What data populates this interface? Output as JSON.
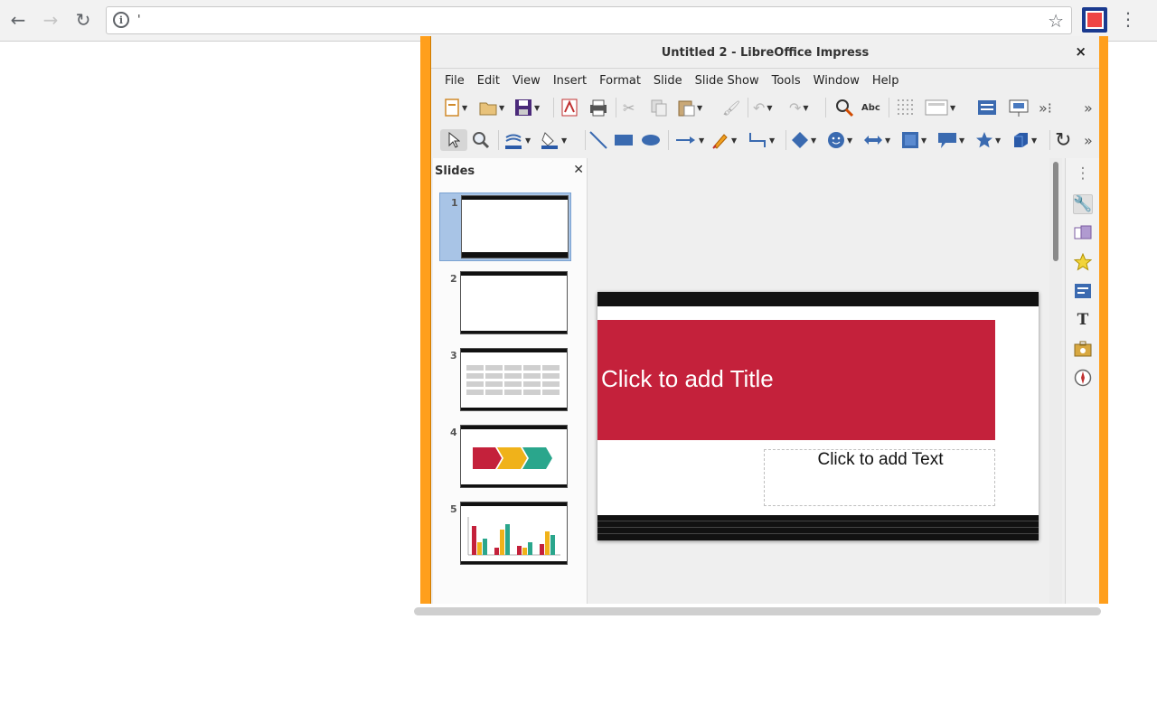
{
  "browser": {
    "url_text": "'",
    "icons": [
      "back-icon",
      "forward-icon",
      "reload-icon",
      "info-icon",
      "bookmark-star-icon",
      "extension-icon",
      "more-vertical-icon"
    ]
  },
  "window": {
    "title": "Untitled 2 - LibreOffice Impress",
    "close": "×"
  },
  "menu": [
    "File",
    "Edit",
    "View",
    "Insert",
    "Format",
    "Slide",
    "Slide Show",
    "Tools",
    "Window",
    "Help"
  ],
  "slides_pane": {
    "label": "Slides",
    "close": "✕",
    "slides": [
      {
        "number": "1"
      },
      {
        "number": "2"
      },
      {
        "number": "3"
      },
      {
        "number": "4"
      },
      {
        "number": "5"
      }
    ]
  },
  "slide": {
    "title_placeholder": "Click to add Title",
    "text_placeholder": "Click to add Text"
  },
  "colors": {
    "title_red": "#c4213b",
    "border_orange": "#ff9f1c",
    "arrow_yellow": "#f0b21a",
    "arrow_teal": "#2aa68c"
  }
}
